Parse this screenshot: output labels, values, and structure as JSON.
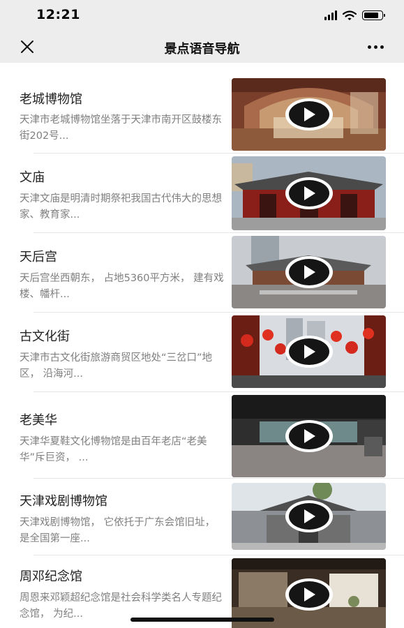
{
  "status_bar": {
    "time": "12:21"
  },
  "nav": {
    "title": "景点语音导航"
  },
  "colors": {
    "nav_background": "#ededed",
    "description_text": "#7f7f7f"
  },
  "icons": [
    "close-icon",
    "more-icon",
    "play-icon",
    "signal-icon",
    "wifi-icon",
    "battery-icon"
  ],
  "items": [
    {
      "title": "老城博物馆",
      "description": "天津市老城博物馆坐落于天津市南开区鼓楼东街202号..."
    },
    {
      "title": "文庙",
      "description": "天津文庙是明清时期祭祀我国古代伟大的思想家、教育家..."
    },
    {
      "title": "天后宫",
      "description": "天后宫坐西朝东， 占地5360平方米， 建有戏楼、幡杆..."
    },
    {
      "title": "古文化街",
      "description": "天津市古文化街旅游商贸区地处“三岔口”地区， 沿海河..."
    },
    {
      "title": "老美华",
      "description": "天津华夏鞋文化博物馆是由百年老店“老美华”斥巨资， ..."
    },
    {
      "title": "天津戏剧博物馆",
      "description": "天津戏剧博物馆， 它依托于广东会馆旧址， 是全国第一座..."
    },
    {
      "title": "周邓纪念馆",
      "description": "周恩来邓颖超纪念馆是社会科学类名人专题纪念馆， 为纪..."
    }
  ]
}
